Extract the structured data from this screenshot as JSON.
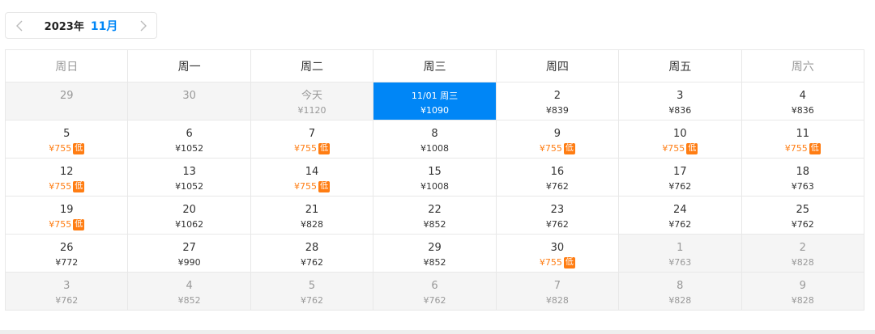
{
  "nav": {
    "year": "2023年",
    "month": "11月",
    "prev_icon": "chevron-left-icon",
    "next_icon": "chevron-right-icon"
  },
  "weekdays": [
    "周日",
    "周一",
    "周二",
    "周三",
    "周四",
    "周五",
    "周六"
  ],
  "colors": {
    "accent": "#0086f6",
    "low_price": "#ff7d13",
    "muted": "#999999",
    "other_month_bg": "#f5f5f5",
    "border": "#e8e8e8"
  },
  "weeks": [
    [
      {
        "day": "29",
        "price": "",
        "state": "other"
      },
      {
        "day": "30",
        "price": "",
        "state": "other"
      },
      {
        "day": "今天",
        "price": "¥1120",
        "state": "other"
      },
      {
        "day": "11/01 周三",
        "price": "¥1090",
        "state": "selected"
      },
      {
        "day": "2",
        "price": "¥839",
        "state": "normal"
      },
      {
        "day": "3",
        "price": "¥836",
        "state": "normal"
      },
      {
        "day": "4",
        "price": "¥836",
        "state": "normal"
      }
    ],
    [
      {
        "day": "5",
        "price": "¥755",
        "state": "normal",
        "low": true
      },
      {
        "day": "6",
        "price": "¥1052",
        "state": "normal"
      },
      {
        "day": "7",
        "price": "¥755",
        "state": "normal",
        "low": true
      },
      {
        "day": "8",
        "price": "¥1008",
        "state": "normal"
      },
      {
        "day": "9",
        "price": "¥755",
        "state": "normal",
        "low": true
      },
      {
        "day": "10",
        "price": "¥755",
        "state": "normal",
        "low": true
      },
      {
        "day": "11",
        "price": "¥755",
        "state": "normal",
        "low": true
      }
    ],
    [
      {
        "day": "12",
        "price": "¥755",
        "state": "normal",
        "low": true
      },
      {
        "day": "13",
        "price": "¥1052",
        "state": "normal"
      },
      {
        "day": "14",
        "price": "¥755",
        "state": "normal",
        "low": true
      },
      {
        "day": "15",
        "price": "¥1008",
        "state": "normal"
      },
      {
        "day": "16",
        "price": "¥762",
        "state": "normal"
      },
      {
        "day": "17",
        "price": "¥762",
        "state": "normal"
      },
      {
        "day": "18",
        "price": "¥763",
        "state": "normal"
      }
    ],
    [
      {
        "day": "19",
        "price": "¥755",
        "state": "normal",
        "low": true
      },
      {
        "day": "20",
        "price": "¥1062",
        "state": "normal"
      },
      {
        "day": "21",
        "price": "¥828",
        "state": "normal"
      },
      {
        "day": "22",
        "price": "¥852",
        "state": "normal"
      },
      {
        "day": "23",
        "price": "¥762",
        "state": "normal"
      },
      {
        "day": "24",
        "price": "¥762",
        "state": "normal"
      },
      {
        "day": "25",
        "price": "¥762",
        "state": "normal"
      }
    ],
    [
      {
        "day": "26",
        "price": "¥772",
        "state": "normal"
      },
      {
        "day": "27",
        "price": "¥990",
        "state": "normal"
      },
      {
        "day": "28",
        "price": "¥762",
        "state": "normal"
      },
      {
        "day": "29",
        "price": "¥852",
        "state": "normal"
      },
      {
        "day": "30",
        "price": "¥755",
        "state": "normal",
        "low": true
      },
      {
        "day": "1",
        "price": "¥763",
        "state": "other"
      },
      {
        "day": "2",
        "price": "¥828",
        "state": "other"
      }
    ],
    [
      {
        "day": "3",
        "price": "¥762",
        "state": "other"
      },
      {
        "day": "4",
        "price": "¥852",
        "state": "other"
      },
      {
        "day": "5",
        "price": "¥762",
        "state": "other"
      },
      {
        "day": "6",
        "price": "¥762",
        "state": "other"
      },
      {
        "day": "7",
        "price": "¥828",
        "state": "other"
      },
      {
        "day": "8",
        "price": "¥828",
        "state": "other"
      },
      {
        "day": "9",
        "price": "¥828",
        "state": "other"
      }
    ]
  ],
  "low_badge_label": "低"
}
